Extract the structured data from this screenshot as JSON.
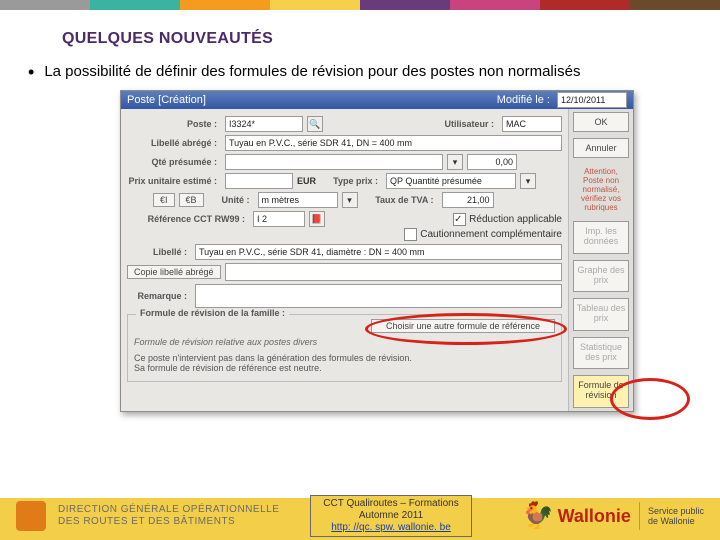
{
  "topbar_colors": [
    "grey",
    "teal",
    "orange",
    "yellow",
    "purple",
    "pink",
    "red",
    "brown"
  ],
  "slide": {
    "title": "QUELQUES NOUVEAUTÉS",
    "bullet": "La possibilité de définir des formules de révision pour des postes non normalisés"
  },
  "window": {
    "titlebar_left": "Poste [Création]",
    "titlebar_mod_label": "Modifié le :",
    "titlebar_mod_value": "12/10/2011",
    "fields": {
      "poste_label": "Poste :",
      "poste_value": "I3324*",
      "user_label": "Utilisateur :",
      "user_value": "MAC",
      "libelle_abrege_label": "Libellé abrégé :",
      "libelle_abrege_value": "Tuyau en P.V.C., série SDR 41, DN = 400 mm",
      "qte_label": "Qté présumée :",
      "qte_unit": "0,00",
      "pu_label": "Prix unitaire estimé :",
      "eur_label": "EUR",
      "type_label": "Type prix :",
      "type_value": "QP Quantité présumée",
      "cur_btn1": "€I",
      "cur_btn2": "€B",
      "unite_label": "Unité :",
      "unite_value": "m mètres",
      "tva_label": "Taux de TVA :",
      "tva_value": "21,00",
      "ref_label": "Référence CCT RW99 :",
      "ref_value": "I 2",
      "chk_reduction": "Réduction applicable",
      "chk_caution": "Cautionnement complémentaire",
      "libelle_label": "Libellé :",
      "libelle_value": "Tuyau en P.V.C., série SDR 41, diamètre : DN = 400 mm",
      "copie_btn": "Copie libellé abrégé",
      "remarque_label": "Remarque :",
      "section_title": "Formule de révision de la famille :",
      "section_btn": "Choisir une autre formule de référence",
      "section_line1": "Formule de révision relative aux postes divers",
      "section_line2": "Ce poste n'intervient pas dans la génération des formules de révision.",
      "section_line3": "Sa formule de révision de référence est neutre."
    },
    "right_buttons": {
      "ok": "OK",
      "annuler": "Annuler",
      "warn": "Attention, Poste non normalisé, vérifiez vos rubriques",
      "imp": "Imp. les données",
      "graphe": "Graphe des prix",
      "tableau": "Tableau des prix",
      "stat": "Statistique des prix",
      "formule": "Formule de révision"
    }
  },
  "footer": {
    "dgo_line1": "DIRECTION GÉNÉRALE OPÉRATIONNELLE",
    "dgo_line2": "DES ROUTES ET DES BÂTIMENTS",
    "center_line1": "CCT Qualiroutes – Formations",
    "center_line2": "Automne 2011",
    "center_link": "http: //qc. spw. wallonie. be",
    "wallonie": "Wallonie",
    "spw_line1": "Service public",
    "spw_line2": "de Wallonie"
  }
}
